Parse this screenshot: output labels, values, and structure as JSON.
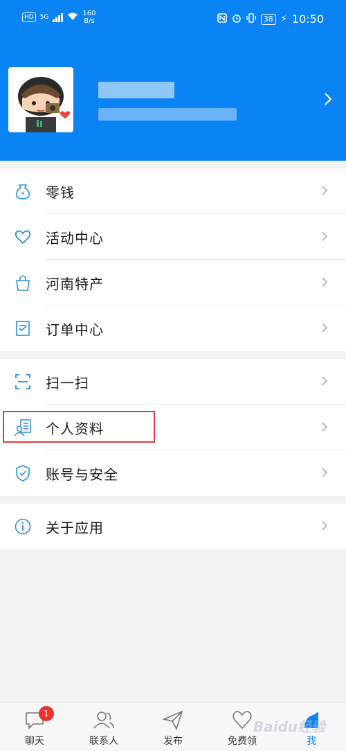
{
  "status_bar": {
    "hd": "HD",
    "net": "5G",
    "speed_value": "160",
    "speed_unit": "B/s",
    "battery": "38",
    "time": "10:50"
  },
  "profile": {
    "name_hidden": true
  },
  "sections": [
    {
      "items": [
        {
          "label": "零钱",
          "icon": "wallet-icon"
        },
        {
          "label": "活动中心",
          "icon": "heart-icon"
        },
        {
          "label": "河南特产",
          "icon": "shopping-bag-icon"
        },
        {
          "label": "订单中心",
          "icon": "order-icon"
        }
      ]
    },
    {
      "items": [
        {
          "label": "扫一扫",
          "icon": "scan-icon"
        },
        {
          "label": "个人资料",
          "icon": "profile-doc-icon"
        },
        {
          "label": "账号与安全",
          "icon": "shield-icon"
        }
      ]
    },
    {
      "items": [
        {
          "label": "关于应用",
          "icon": "info-icon"
        }
      ]
    }
  ],
  "tabbar": {
    "tabs": [
      {
        "label": "聊天",
        "icon": "chat-icon",
        "badge": "1"
      },
      {
        "label": "联系人",
        "icon": "contacts-icon"
      },
      {
        "label": "发布",
        "icon": "send-icon"
      },
      {
        "label": "免费领",
        "icon": "heart-icon"
      },
      {
        "label": "我",
        "icon": "me-icon",
        "active": true
      }
    ]
  },
  "watermark": "Baidu经验",
  "colors": {
    "primary": "#0a84f5",
    "icon": "#2b8fd6",
    "highlight": "#e23b3b",
    "badge": "#f0322e"
  }
}
